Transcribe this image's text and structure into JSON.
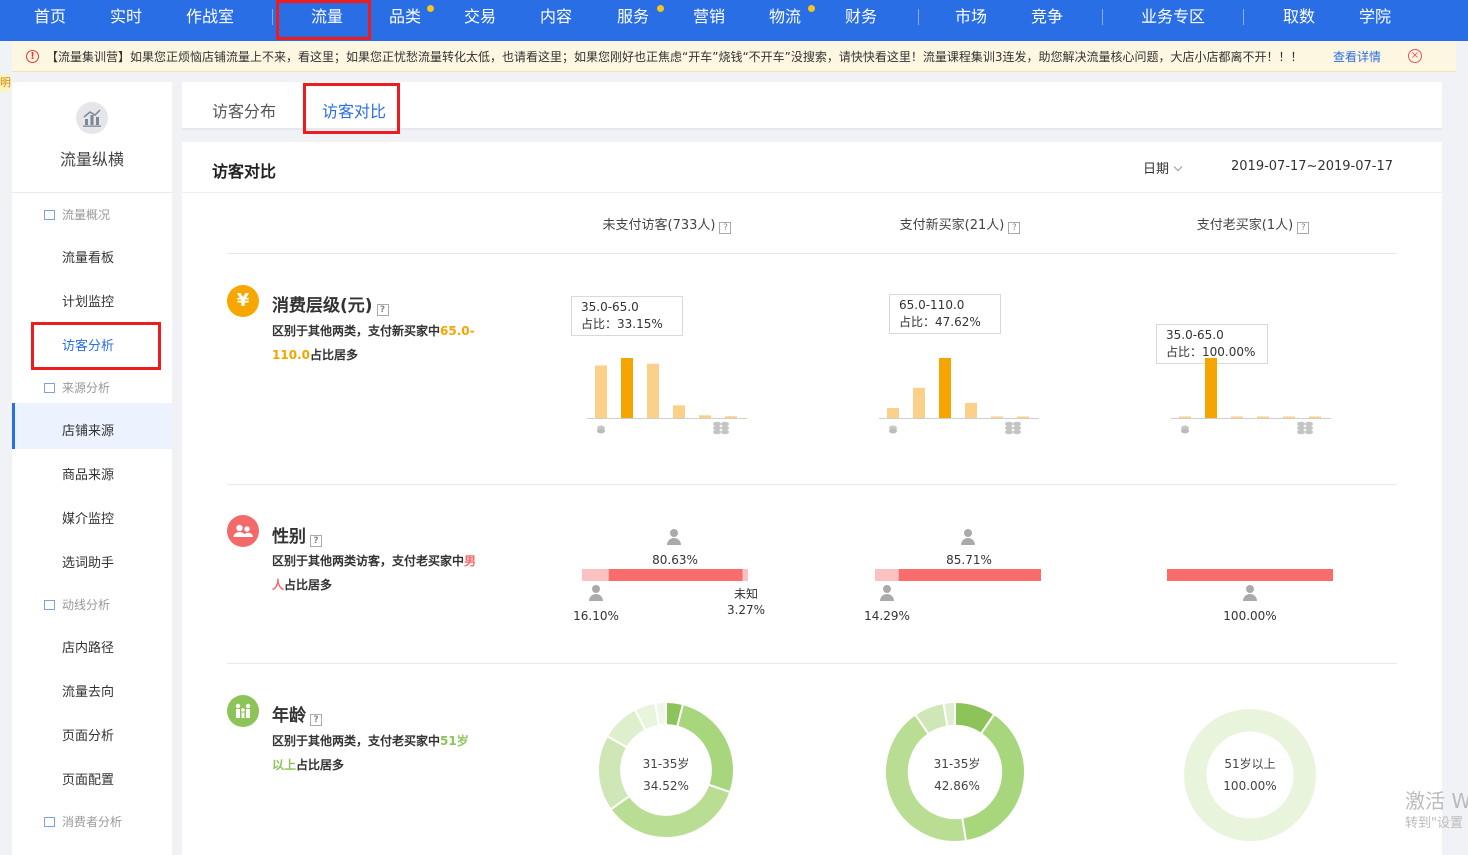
{
  "topnav": {
    "items": [
      "首页",
      "实时",
      "作战室",
      "流量",
      "品类",
      "交易",
      "内容",
      "服务",
      "营销",
      "物流",
      "财务",
      "市场",
      "竞争",
      "业务专区",
      "取数",
      "学院"
    ],
    "accent": "#2a6ee6"
  },
  "notice": {
    "text": "【流量集训营】如果您正烦恼店铺流量上不来，看这里；如果您正忧愁流量转化太低，也请看这里；如果您刚好也正焦虑“开车”烧钱“不开车”没搜索，请快快看这里！流量课程集训3连发，助您解决流量核心问题，大店小店都离不开！！！",
    "link": "查看详情",
    "edge_mark": "明"
  },
  "sidebar": {
    "title": "流量纵横",
    "groups": [
      {
        "label": "流量概况",
        "items": [
          "流量看板",
          "计划监控",
          "访客分析"
        ]
      },
      {
        "label": "来源分析",
        "items": [
          "店铺来源",
          "商品来源",
          "媒介监控",
          "选词助手"
        ]
      },
      {
        "label": "动线分析",
        "items": [
          "店内路径",
          "流量去向",
          "页面分析",
          "页面配置"
        ]
      },
      {
        "label": "消费者分析",
        "items": []
      }
    ]
  },
  "tabs": [
    "访客分布",
    "访客对比"
  ],
  "panel": {
    "title": "访客对比",
    "date_label": "日期",
    "date_range": "2019-07-17~2019-07-17",
    "columns": [
      "未支付访客(733人)",
      "支付新买家(21人)",
      "支付老买家(1人)"
    ],
    "help": "?"
  },
  "sections": {
    "consumption": {
      "title": "消费层级(元)",
      "icon": "¥",
      "desc_pre": "区别于其他两类，支付新买家中",
      "desc_hi": "65.0-110.0",
      "desc_post": "占比居多",
      "tooltips": [
        {
          "range": "35.0-65.0",
          "share": "占比：33.15%"
        },
        {
          "range": "65.0-110.0",
          "share": "占比：47.62%"
        },
        {
          "range": "35.0-65.0",
          "share": "占比：100.00%"
        }
      ]
    },
    "gender": {
      "title": "性别",
      "desc_pre": "区别于其他两类访客，支付老买家中",
      "desc_hi": "男人",
      "desc_post": "占比居多",
      "unknown_label": "未知"
    },
    "age": {
      "title": "年龄",
      "desc_pre": "区别于其他两类，支付老买家中",
      "desc_hi": "51岁以上",
      "desc_post": "占比居多",
      "centers": [
        {
          "label": "31-35岁",
          "value": "34.52%"
        },
        {
          "label": "31-35岁",
          "value": "42.86%"
        },
        {
          "label": "51岁以上",
          "value": "100.00%"
        }
      ]
    }
  },
  "chart_data": [
    {
      "type": "bar",
      "title": "消费层级(元)",
      "series": [
        {
          "name": "未支付访客(733人)",
          "values": [
            0.29,
            0.3315,
            0.3,
            0.07,
            0.015,
            0.01
          ],
          "highlight_index": 1
        },
        {
          "name": "支付新买家(21人)",
          "values": [
            0.08,
            0.24,
            0.4762,
            0.12,
            0.01,
            0.01
          ],
          "highlight_index": 2
        },
        {
          "name": "支付老买家(1人)",
          "values": [
            0.005,
            1.0,
            0.005,
            0.005,
            0.005,
            0.005
          ],
          "highlight_index": 1
        }
      ],
      "colors": {
        "normal": "#fdd08a",
        "highlight": "#f5a400"
      }
    },
    {
      "type": "bar",
      "title": "性别",
      "series": [
        {
          "name": "未支付访客(733人)",
          "female": 16.1,
          "male": 80.63,
          "unknown": 3.27,
          "labels": [
            "16.10%",
            "80.63%",
            "3.27%"
          ]
        },
        {
          "name": "支付新买家(21人)",
          "female": 14.29,
          "male": 85.71,
          "unknown": 0,
          "labels": [
            "14.29%",
            "85.71%"
          ]
        },
        {
          "name": "支付老买家(1人)",
          "female": 0,
          "male": 100.0,
          "unknown": 0,
          "labels": [
            "100.00%"
          ]
        }
      ],
      "colors": {
        "male": "#f86c6b",
        "female": "#f9c1c1",
        "unknown": "#f9c1c1"
      }
    },
    {
      "type": "pie",
      "title": "年龄",
      "series": [
        {
          "name": "未支付访客(733人)",
          "values": [
            0.04,
            0.26,
            0.3452,
            0.18,
            0.09,
            0.05,
            0.025
          ]
        },
        {
          "name": "支付新买家(21人)",
          "values": [
            0.095,
            0.38,
            0.4286,
            0.07,
            0.0264
          ]
        },
        {
          "name": "支付老买家(1人)",
          "values": [
            1.0
          ]
        }
      ],
      "colors": [
        "#8cc45a",
        "#a8d67d",
        "#b9dd93",
        "#cfe7b6",
        "#deefcd",
        "#e9f4dd",
        "#f0f7e9"
      ]
    }
  ]
}
